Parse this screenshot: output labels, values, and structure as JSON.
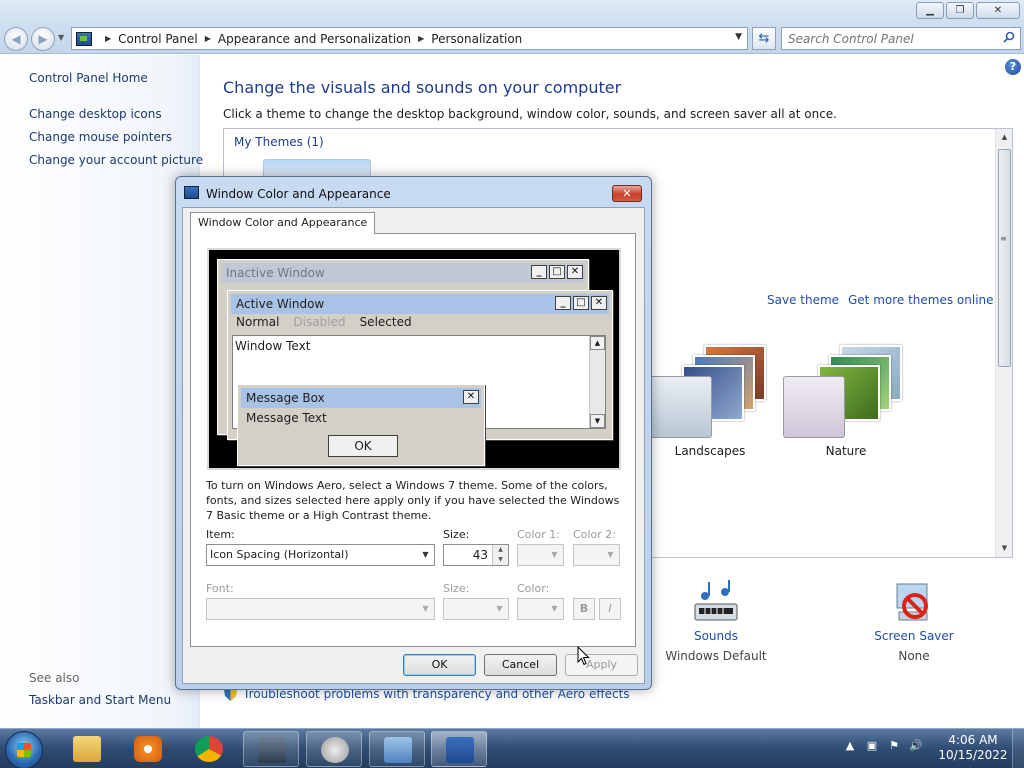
{
  "window": {
    "minimize_glyph": "▁",
    "maximize_glyph": "❐",
    "close_glyph": "✕"
  },
  "nav": {
    "back_glyph": "◀",
    "forward_glyph": "▶",
    "breadcrumb": [
      "Control Panel",
      "Appearance and Personalization",
      "Personalization"
    ],
    "search_placeholder": "Search Control Panel"
  },
  "left_pane": {
    "home": "Control Panel Home",
    "links": [
      "Change desktop icons",
      "Change mouse pointers",
      "Change your account picture"
    ],
    "see_also_label": "See also",
    "see_also_links": [
      "Taskbar and Start Menu"
    ]
  },
  "main": {
    "help_glyph": "?",
    "title": "Change the visuals and sounds on your computer",
    "subtitle": "Click a theme to change the desktop background, window color, sounds, and screen saver all at once.",
    "my_themes": "My Themes (1)",
    "save_theme": "Save theme",
    "get_more_themes": "Get more themes online",
    "themes": [
      "Landscapes",
      "Nature"
    ],
    "bottom": {
      "sounds_title": "Sounds",
      "sounds_value": "Windows Default",
      "screensaver_title": "Screen Saver",
      "screensaver_value": "None"
    },
    "troubleshoot": "Troubleshoot problems with transparency and other Aero effects"
  },
  "dialog": {
    "title": "Window Color and Appearance",
    "tab": "Window Color and Appearance",
    "preview": {
      "inactive_title": "Inactive Window",
      "active_title": "Active Window",
      "menu_normal": "Normal",
      "menu_disabled": "Disabled",
      "menu_selected": "Selected",
      "window_text": "Window Text",
      "msgbox_title": "Message Box",
      "msgbox_text": "Message Text",
      "msgbox_ok": "OK"
    },
    "info": "To turn on Windows Aero, select a Windows 7 theme.  Some of the colors, fonts, and sizes selected here apply only if you have selected the Windows 7 Basic theme or a High Contrast theme.",
    "item_label": "Item:",
    "item_value": "Icon Spacing (Horizontal)",
    "size_label": "Size:",
    "size_value": "43",
    "color1_label": "Color 1:",
    "color2_label": "Color 2:",
    "font_label": "Font:",
    "font_size_label": "Size:",
    "font_color_label": "Color:",
    "bold_label": "B",
    "italic_label": "I",
    "ok": "OK",
    "cancel": "Cancel",
    "apply": "Apply"
  },
  "taskbar": {
    "time": "4:06 AM",
    "date": "10/15/2022",
    "tray_glyphs": [
      "▲",
      "▣",
      "⚑",
      "🔊"
    ]
  },
  "colors": {
    "link": "#1e4fa8",
    "heading": "#1e3c8c",
    "inactive_caption": "#c0c8d4",
    "active_caption": "#a9c3e6"
  }
}
